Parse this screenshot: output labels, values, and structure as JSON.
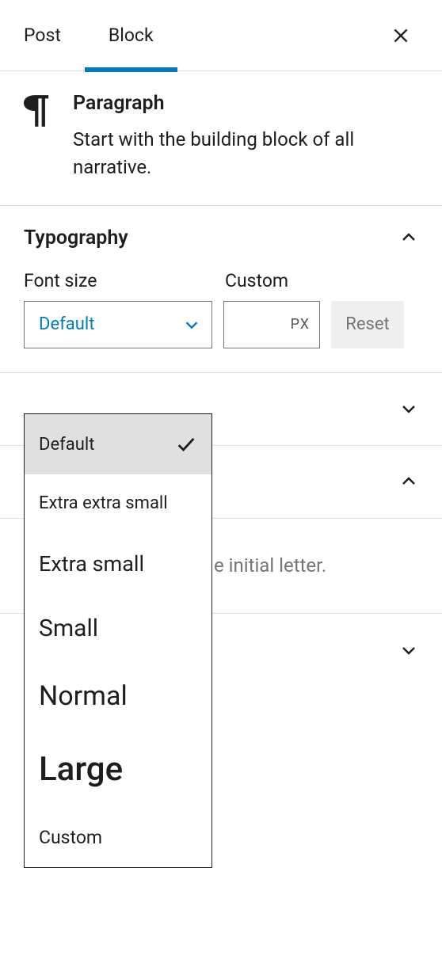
{
  "tabs": {
    "post": "Post",
    "block": "Block"
  },
  "block": {
    "title": "Paragraph",
    "description": "Start with the building block of all narrative."
  },
  "typography": {
    "title": "Typography",
    "font_size_label": "Font size",
    "custom_label": "Custom",
    "selected": "Default",
    "custom_unit": "PX",
    "reset": "Reset",
    "options": {
      "default": "Default",
      "xxs": "Extra extra small",
      "xs": "Extra small",
      "sm": "Small",
      "nm": "Normal",
      "lg": "Large",
      "custom": "Custom"
    }
  },
  "peek": "e initial letter."
}
